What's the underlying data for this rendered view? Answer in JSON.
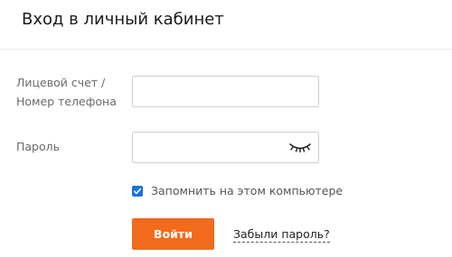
{
  "header": {
    "title": "Вход в личный кабинет"
  },
  "form": {
    "account_label_line1": "Лицевой счет /",
    "account_label_line2": "Номер телефона",
    "account_value": "",
    "password_label": "Пароль",
    "password_value": "",
    "password_toggle_icon": "eye-closed-icon",
    "remember_label": "Запомнить на этом компьютере",
    "remember_checked": true,
    "login_button_label": "Войти",
    "forgot_link_label": "Забыли пароль?"
  },
  "colors": {
    "accent": "#f26a1b",
    "checkbox": "#1a73d9"
  }
}
